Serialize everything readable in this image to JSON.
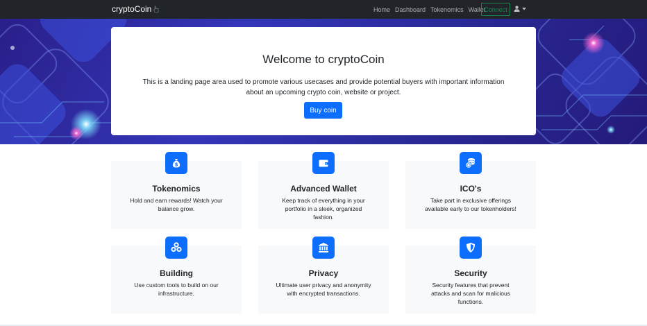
{
  "navbar": {
    "brand": "cryptoCoin",
    "links": [
      "Home",
      "Dashboard",
      "Tokenomics",
      "Wallet"
    ],
    "connect_label": "Connect"
  },
  "hero": {
    "title": "Welcome to cryptoCoin",
    "text": "This is a landing page area used to promote various usecases and provide potential buyers with important information about an upcoming crypto coin, website or project.",
    "button_label": "Buy coin"
  },
  "features": [
    {
      "icon": "money-bag-icon",
      "title": "Tokenomics",
      "text": "Hold and earn rewards! Watch your balance grow."
    },
    {
      "icon": "wallet-icon",
      "title": "Advanced Wallet",
      "text": "Keep track of everything in your portfolio in a sleek, organized fashion."
    },
    {
      "icon": "coins-icon",
      "title": "ICO's",
      "text": "Take part in exclusive offerings available early to our tokenholders!"
    },
    {
      "icon": "cubes-icon",
      "title": "Building",
      "text": "Use custom tools to build on our infrastructure."
    },
    {
      "icon": "bank-icon",
      "title": "Privacy",
      "text": "Ultimate user privacy and anonymity with encrypted transactions."
    },
    {
      "icon": "shield-icon",
      "title": "Security",
      "text": "Security features that prevent attacks and scan for malicious functions."
    }
  ],
  "colors": {
    "navbar_bg": "#212529",
    "primary": "#0d6efd",
    "success": "#198754",
    "card_bg": "#f8f9fa"
  }
}
